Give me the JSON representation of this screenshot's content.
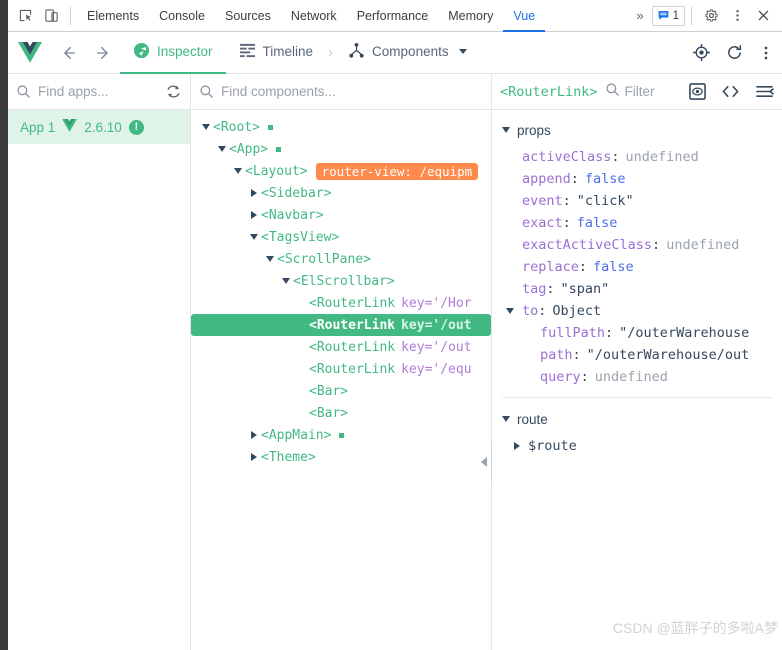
{
  "devtools_bar": {
    "icons": [
      {
        "name": "inspect-element-icon"
      },
      {
        "name": "device-toolbar-icon"
      }
    ],
    "tabs": [
      {
        "label": "Elements",
        "active": false
      },
      {
        "label": "Console",
        "active": false
      },
      {
        "label": "Sources",
        "active": false
      },
      {
        "label": "Network",
        "active": false
      },
      {
        "label": "Performance",
        "active": false
      },
      {
        "label": "Memory",
        "active": false
      },
      {
        "label": "Vue",
        "active": true
      }
    ],
    "overflow_label": "»",
    "message_count": "1",
    "settings_icon": "gear-icon",
    "more_icon": "kebab-menu-icon",
    "close_icon": "close-icon",
    "active_tab_color": "#1a73e8"
  },
  "vue_toolbar": {
    "logo": "vue-logo-icon",
    "back_icon": "arrow-left-icon",
    "forward_icon": "arrow-right-icon",
    "tabs": [
      {
        "label": "Inspector",
        "icon": "inspector-icon",
        "active": true
      },
      {
        "label": "Timeline",
        "icon": "timeline-icon",
        "active": false
      },
      {
        "label": "Components",
        "icon": "components-tree-icon",
        "active": false,
        "has_caret": true
      }
    ],
    "separator": "›",
    "right_icons": [
      {
        "name": "select-component-target-icon"
      },
      {
        "name": "refresh-icon"
      },
      {
        "name": "kebab-menu-icon"
      }
    ],
    "accent_color": "#42b983"
  },
  "apps_panel": {
    "search_placeholder": "Find apps...",
    "search_value": "",
    "search_icon": "search-icon",
    "refresh_icon": "refresh-apps-icon",
    "apps": [
      {
        "name": "App 1",
        "version": "2.6.10",
        "badge": "!",
        "selected": true
      }
    ]
  },
  "tree_panel": {
    "search_placeholder": "Find components...",
    "search_value": "",
    "search_icon": "search-icon",
    "rows": [
      {
        "depth": 0,
        "toggle": "down",
        "tag": "<Root>",
        "dot": true,
        "selected": false
      },
      {
        "depth": 1,
        "toggle": "down",
        "tag": "<App>",
        "dot": true,
        "selected": false
      },
      {
        "depth": 2,
        "toggle": "down",
        "tag": "<Layout>",
        "dot": false,
        "selected": false,
        "chip": "router-view: /equipm"
      },
      {
        "depth": 3,
        "toggle": "right",
        "tag": "<Sidebar>",
        "dot": false,
        "selected": false
      },
      {
        "depth": 3,
        "toggle": "right",
        "tag": "<Navbar>",
        "dot": false,
        "selected": false
      },
      {
        "depth": 3,
        "toggle": "down",
        "tag": "<TagsView>",
        "dot": false,
        "selected": false
      },
      {
        "depth": 4,
        "toggle": "down",
        "tag": "<ScrollPane>",
        "dot": false,
        "selected": false
      },
      {
        "depth": 5,
        "toggle": "down",
        "tag": "<ElScrollbar>",
        "dot": false,
        "selected": false
      },
      {
        "depth": 6,
        "toggle": "none",
        "tag": "<RouterLink",
        "attr": "key='/Hor",
        "dot": false,
        "selected": false
      },
      {
        "depth": 6,
        "toggle": "none",
        "tag": "<RouterLink",
        "attr": "key='/out",
        "dot": false,
        "selected": true
      },
      {
        "depth": 6,
        "toggle": "none",
        "tag": "<RouterLink",
        "attr": "key='/out",
        "dot": false,
        "selected": false
      },
      {
        "depth": 6,
        "toggle": "none",
        "tag": "<RouterLink",
        "attr": "key='/equ",
        "dot": false,
        "selected": false
      },
      {
        "depth": 6,
        "toggle": "none",
        "tag": "<Bar>",
        "dot": false,
        "selected": false
      },
      {
        "depth": 6,
        "toggle": "none",
        "tag": "<Bar>",
        "dot": false,
        "selected": false
      },
      {
        "depth": 3,
        "toggle": "right",
        "tag": "<AppMain>",
        "dot": true,
        "selected": false
      },
      {
        "depth": 3,
        "toggle": "right",
        "tag": "<Theme>",
        "dot": false,
        "selected": false
      }
    ],
    "selected_bg": "#42b983",
    "chip_bg": "#ff8a4c",
    "collapse_handle_icon": "collapse-left-arrow-icon"
  },
  "detail_panel": {
    "title": "<RouterLink>",
    "filter_placeholder": "Filter",
    "filter_value": "",
    "search_icon": "search-icon",
    "icons": [
      {
        "name": "inspect-dom-icon"
      },
      {
        "name": "open-in-editor-icon"
      },
      {
        "name": "collapse-all-icon"
      }
    ],
    "sections": [
      {
        "name": "props",
        "expanded": true,
        "rows": [
          {
            "key": "activeClass",
            "value": "undefined",
            "type": "undefined",
            "indent": 1
          },
          {
            "key": "append",
            "value": "false",
            "type": "bool",
            "indent": 1
          },
          {
            "key": "event",
            "value": "\"click\"",
            "type": "string",
            "indent": 1
          },
          {
            "key": "exact",
            "value": "false",
            "type": "bool",
            "indent": 1
          },
          {
            "key": "exactActiveClass",
            "value": "undefined",
            "type": "undefined",
            "indent": 1
          },
          {
            "key": "replace",
            "value": "false",
            "type": "bool",
            "indent": 1
          },
          {
            "key": "tag",
            "value": "\"span\"",
            "type": "string",
            "indent": 1
          },
          {
            "key": "to",
            "value": "Object",
            "type": "object",
            "indent": 1,
            "toggle": "down"
          },
          {
            "key": "fullPath",
            "value": "\"/outerWarehouse",
            "type": "string",
            "indent": 2
          },
          {
            "key": "path",
            "value": "\"/outerWarehouse/out",
            "type": "string",
            "indent": 2
          },
          {
            "key": "query",
            "value": "undefined",
            "type": "undefined",
            "indent": 2
          }
        ]
      },
      {
        "name": "route",
        "expanded": true,
        "items": [
          {
            "label": "$route",
            "toggle": "right"
          }
        ]
      }
    ]
  },
  "watermark": "CSDN @蓝胖子的多啦A梦"
}
